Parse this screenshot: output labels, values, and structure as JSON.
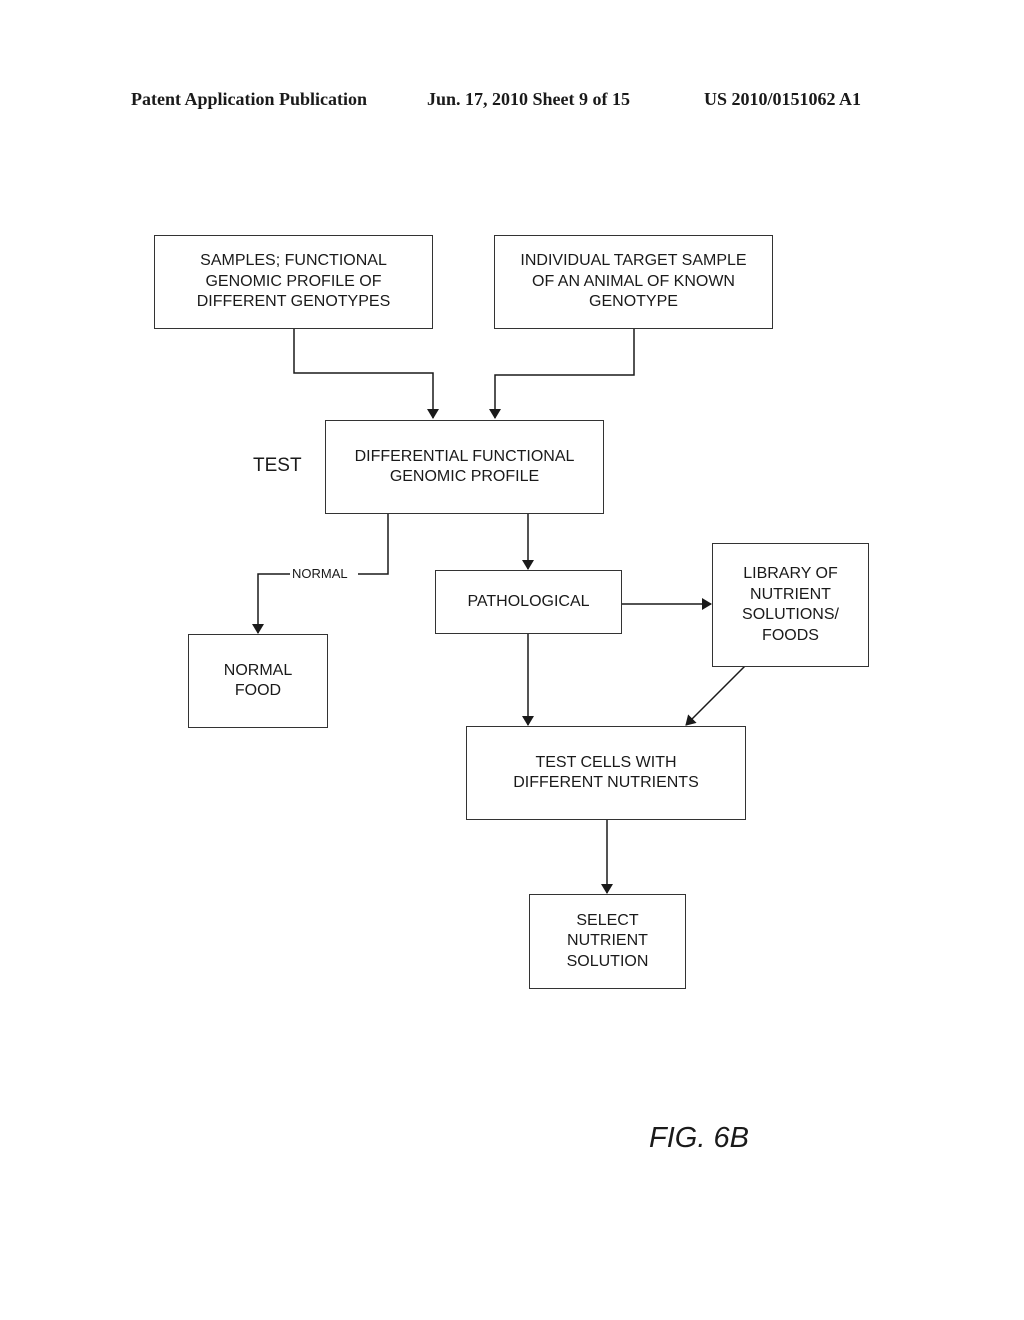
{
  "header": {
    "publication": "Patent Application Publication",
    "date_sheet": "Jun. 17, 2010  Sheet 9 of 15",
    "number": "US 2010/0151062 A1"
  },
  "diagram": {
    "nodes": {
      "samples": "SAMPLES; FUNCTIONAL\nGENOMIC PROFILE OF\nDIFFERENT GENOTYPES",
      "individual": "INDIVIDUAL TARGET SAMPLE\nOF AN ANIMAL OF KNOWN\nGENOTYPE",
      "differential": "DIFFERENTIAL FUNCTIONAL\nGENOMIC PROFILE",
      "pathological": "PATHOLOGICAL",
      "library": "LIBRARY OF\nNUTRIENT\nSOLUTIONS/\nFOODS",
      "normal_food": "NORMAL\nFOOD",
      "test_cells": "TEST CELLS WITH\nDIFFERENT NUTRIENTS",
      "select": "SELECT\nNUTRIENT\nSOLUTION"
    },
    "labels": {
      "test": "TEST",
      "normal_edge": "NORMAL"
    },
    "edges": [
      {
        "from": "samples",
        "to": "differential"
      },
      {
        "from": "individual",
        "to": "differential"
      },
      {
        "from": "differential",
        "to": "normal_food",
        "label": "NORMAL"
      },
      {
        "from": "differential",
        "to": "pathological"
      },
      {
        "from": "pathological",
        "to": "library"
      },
      {
        "from": "pathological",
        "to": "test_cells"
      },
      {
        "from": "library",
        "to": "test_cells"
      },
      {
        "from": "test_cells",
        "to": "select"
      }
    ]
  },
  "figure_label": "FIG. 6B"
}
